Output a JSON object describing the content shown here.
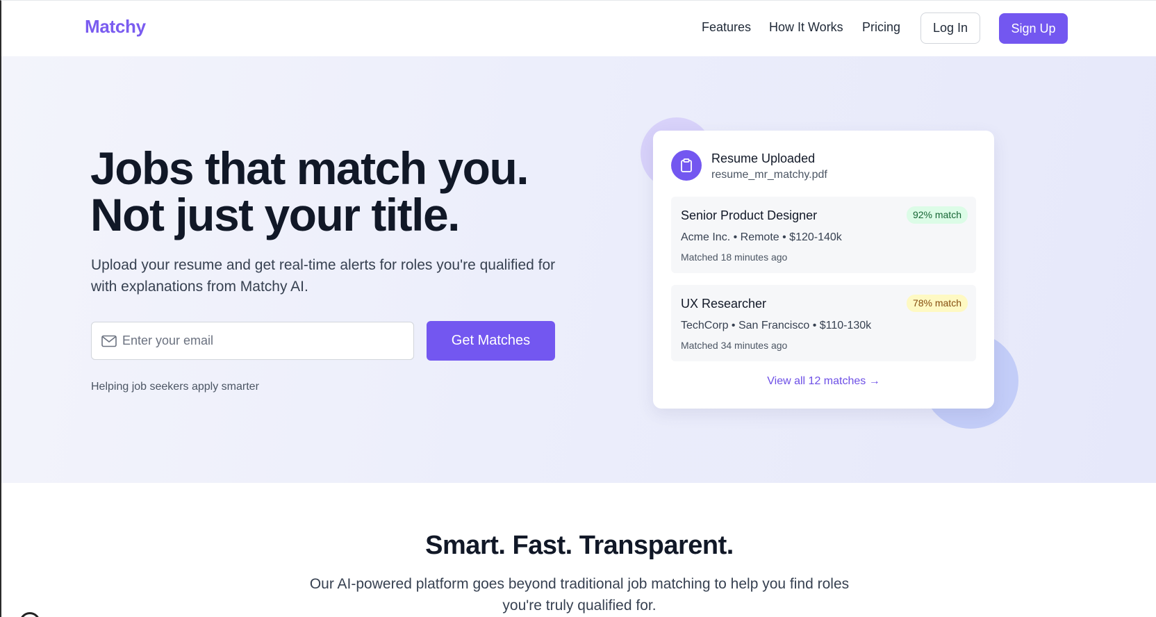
{
  "header": {
    "logo": "Matchy",
    "nav": [
      "Features",
      "How It Works",
      "Pricing"
    ],
    "login_label": "Log In",
    "signup_label": "Sign Up"
  },
  "hero": {
    "title_line1": "Jobs that match you.",
    "title_line2": "Not just your title.",
    "subtitle": "Upload your resume and get real-time alerts for roles you're qualified for with explanations from Matchy AI.",
    "email_placeholder": "Enter your email",
    "email_value": "",
    "cta_label": "Get Matches",
    "helper": "Helping job seekers apply smarter"
  },
  "card": {
    "icon": "clipboard-icon",
    "title": "Resume Uploaded",
    "file": "resume_mr_matchy.pdf",
    "jobs": [
      {
        "title": "Senior Product Designer",
        "badge": "92% match",
        "company": "Acme Inc.",
        "location": "Remote",
        "salary": "$120-140k",
        "time": "Matched 18 minutes ago"
      },
      {
        "title": "UX Researcher",
        "badge": "78% match",
        "company": "TechCorp",
        "location": "San Francisco",
        "salary": "$110-130k",
        "time": "Matched 34 minutes ago"
      }
    ],
    "view_all": "View all 12 matches →"
  },
  "features": {
    "title": "Smart. Fast. Transparent.",
    "subtitle": "Our AI-powered platform goes beyond traditional job matching to help you find roles you're truly qualified for."
  },
  "colors": {
    "accent": "#7357f0",
    "logo": "#7a5cf0",
    "badge_green_bg": "#dcfce7",
    "badge_yellow_bg": "#fef9c3"
  }
}
